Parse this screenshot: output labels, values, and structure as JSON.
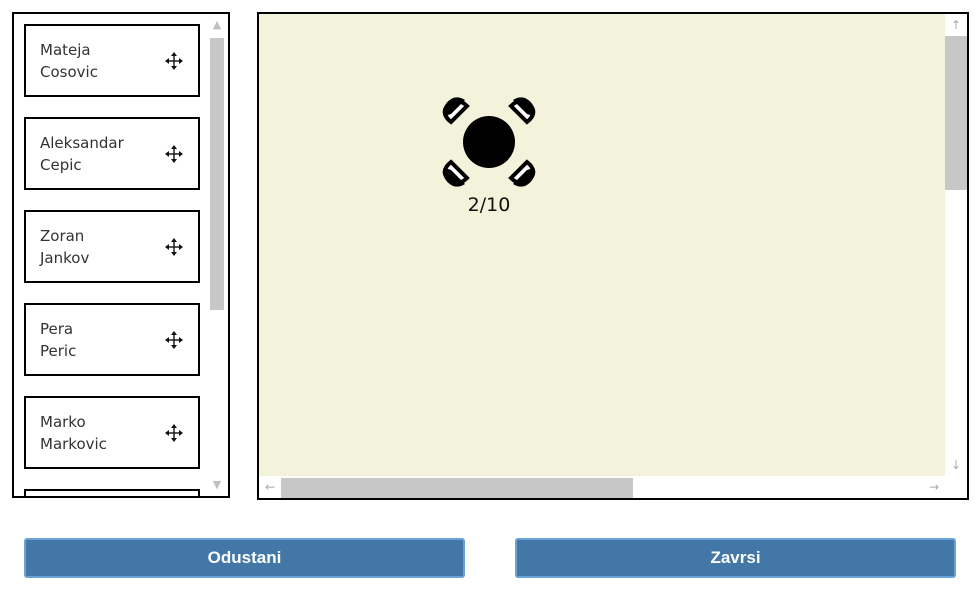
{
  "guests": [
    {
      "first": "Mateja",
      "last": "Cosovic"
    },
    {
      "first": "Aleksandar",
      "last": "Cepic"
    },
    {
      "first": "Zoran",
      "last": "Jankov"
    },
    {
      "first": "Pera",
      "last": "Peric"
    },
    {
      "first": "Marko",
      "last": "Markovic"
    }
  ],
  "floor": {
    "table": {
      "occupancy": "2/10",
      "icon": "round-table-with-chairs-icon"
    },
    "background_color": "#f3f3dc"
  },
  "buttons": {
    "cancel_label": "Odustani",
    "finish_label": "Zavrsi",
    "color": "#4277a8"
  },
  "icons": {
    "guest_handle": "move-arrows-icon",
    "scroll_up": "▲",
    "scroll_down": "▼",
    "arrow_up": "↑",
    "arrow_down": "↓",
    "arrow_left": "←",
    "arrow_right": "→"
  }
}
